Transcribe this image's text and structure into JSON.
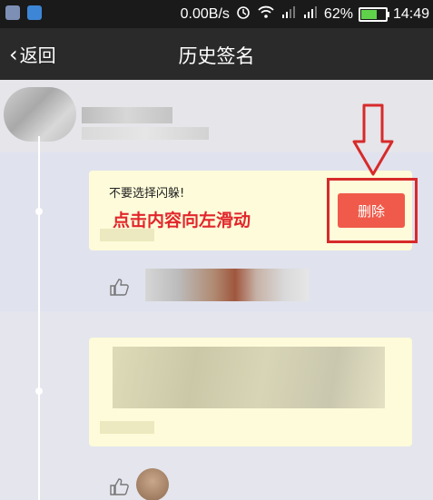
{
  "status_bar": {
    "network_speed": "0.00B/s",
    "battery_percent": "62%",
    "battery_level": 0.62,
    "time": "14:49"
  },
  "header": {
    "back_label": "返回",
    "title": "历史签名"
  },
  "entries": [
    {
      "signature": "不要选择闪躲!",
      "action_label": "删除"
    }
  ],
  "annotation": {
    "instruction": "点击内容向左滑动",
    "highlight_color": "#d72a2a"
  },
  "icons": {
    "back": "chevron-left-icon",
    "like": "thumbs-up-icon",
    "alarm": "alarm-icon",
    "wifi": "wifi-icon",
    "signal": "signal-icon",
    "battery": "battery-icon"
  },
  "colors": {
    "status_bar_bg": "#1a1a1a",
    "title_bar_bg": "#2a2a2a",
    "card_bg": "#fdfbd9",
    "delete_button_bg": "#f05a4a"
  }
}
